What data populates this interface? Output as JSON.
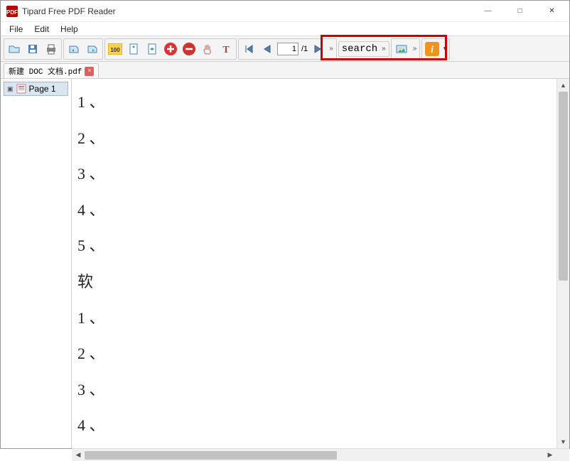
{
  "window": {
    "title": "Tipard Free PDF Reader",
    "minimize": "—",
    "maximize": "□",
    "close": "✕"
  },
  "menubar": [
    "File",
    "Edit",
    "Help"
  ],
  "toolbar": {
    "nav": {
      "page_current": "1",
      "page_total": "/1"
    },
    "search": "search",
    "more": "»"
  },
  "tabs": [
    {
      "label": "新建 DOC 文档.pdf",
      "close": "×"
    }
  ],
  "sidebar": {
    "page_label": "Page 1"
  },
  "document": {
    "lines": [
      "1 、",
      "2 、",
      "3 、",
      "4 、",
      "5 、",
      "软",
      "1 、",
      "2 、",
      "3 、",
      "4 、"
    ]
  },
  "icons": {
    "open": "open-icon",
    "save": "save-icon",
    "print": "print-icon",
    "prev_doc": "prev-doc-icon",
    "next_doc": "next-doc-icon",
    "zoom100": "zoom-100-icon",
    "actual": "actual-icon",
    "fit": "fit-icon",
    "plus": "plus-icon",
    "minus": "minus-icon",
    "hand": "hand-icon",
    "text": "text-icon",
    "first": "first-page-icon",
    "prev": "prev-page-icon",
    "next": "next-page-icon",
    "image": "image-icon",
    "info": "info-icon",
    "dropdown": "dropdown-icon"
  },
  "colors": {
    "highlight": "#cc0000",
    "plus": "#d23",
    "minus": "#c33",
    "info_bg": "#f0941e"
  }
}
